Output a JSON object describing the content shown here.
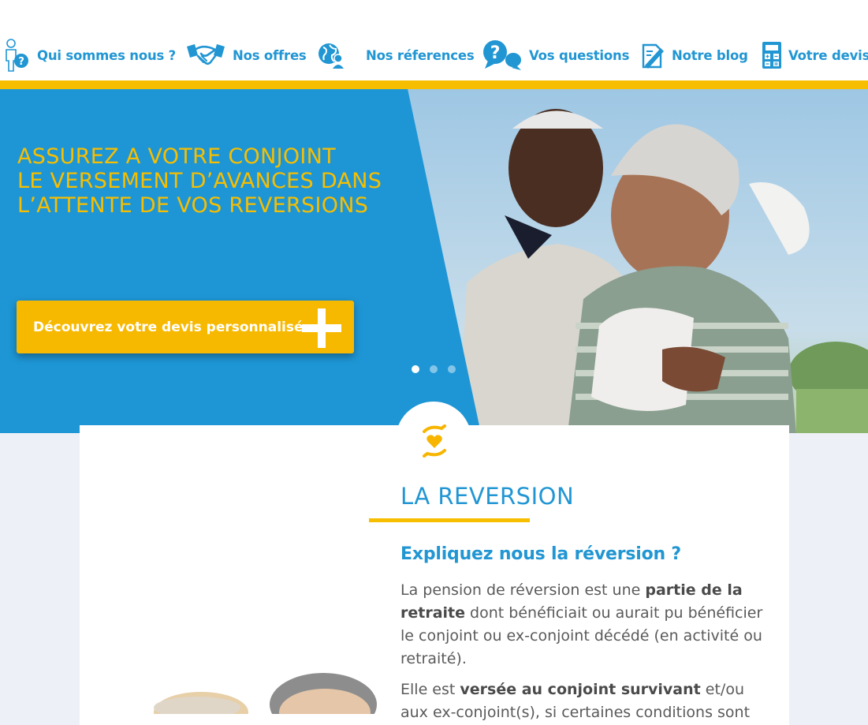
{
  "nav": {
    "items": [
      {
        "label": "Qui sommes nous ?",
        "icon": "person-question-icon"
      },
      {
        "label": "Nos offres",
        "icon": "handshake-icon"
      },
      {
        "label": "Nos réferences",
        "icon": "globe-person-icon"
      },
      {
        "label": "Vos questions",
        "icon": "question-bubbles-icon"
      },
      {
        "label": "Notre blog",
        "icon": "document-pen-icon"
      },
      {
        "label": "Votre devis",
        "icon": "calculator-icon"
      }
    ]
  },
  "hero": {
    "title_lines": [
      "ASSUREZ A VOTRE CONJOINT",
      "LE VERSEMENT D’AVANCES DANS",
      "L’ATTENTE DE VOS REVERSIONS"
    ],
    "cta_label": "Découvrez votre devis personnalisé",
    "slide_count": 3,
    "active_slide": 1
  },
  "section": {
    "badge_icon": "hands-heart-icon",
    "title": "LA REVERSION",
    "subtitle": "Expliquez nous la réversion ?",
    "p1": {
      "t1": "La pension de réversion est une ",
      "b1": "partie de la retraite",
      "t2": " dont bénéficiait ou aurait pu bénéficier le conjoint ou ex-conjoint décédé (en activité ou retraité)."
    },
    "p2": {
      "t1": "Elle est ",
      "b1": "versée au conjoint survivant",
      "t2": " et/ou aux ex-conjoint(s), si certaines conditions sont"
    }
  },
  "colors": {
    "brand_blue": "#1e96d5",
    "brand_yellow": "#f7be00",
    "page_bg": "#edf0f7"
  }
}
